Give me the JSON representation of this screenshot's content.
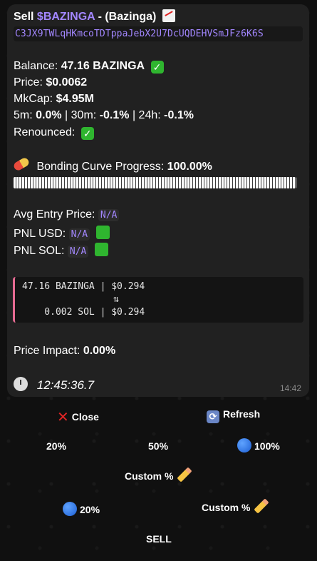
{
  "header": {
    "prefix": "Sell",
    "ticker": "$BAZINGA",
    "separator": "-",
    "name": "(Bazinga)",
    "address": "C3JX9TWLqHKmcoTDTppaJebX2U7DcUQDEHVSmJFz6K6S"
  },
  "stats": {
    "balance_label": "Balance:",
    "balance_value": "47.16 BAZINGA",
    "price_label": "Price:",
    "price_value": "$0.0062",
    "mkcap_label": "MkCap:",
    "mkcap_value": "$4.95M",
    "change_5m_label": "5m:",
    "change_5m": "0.0%",
    "change_30m_label": "30m:",
    "change_30m": "-0.1%",
    "change_24h_label": "24h:",
    "change_24h": "-0.1%",
    "renounced_label": "Renounced:"
  },
  "bonding": {
    "label": "Bonding Curve Progress:",
    "value": "100.00%",
    "progress": 1.0
  },
  "pnl": {
    "avg_entry_label": "Avg Entry Price:",
    "avg_entry_value": "N/A",
    "usd_label": "PNL USD:",
    "usd_value": "N/A",
    "sol_label": "PNL SOL:",
    "sol_value": "N/A"
  },
  "swap": {
    "line1": "47.16 BAZINGA | $0.294",
    "arrow": "⇅",
    "line2": "    0.002 SOL | $0.294"
  },
  "impact": {
    "label": "Price Impact:",
    "value": "0.00%"
  },
  "footer": {
    "time_text": "12:45:36.7",
    "message_time": "14:42"
  },
  "buttons": {
    "close": "Close",
    "refresh": "Refresh",
    "pct_20": "20%",
    "pct_50": "50%",
    "pct_100": "100%",
    "custom_pct": "Custom %",
    "sel_20": "20%",
    "custom_pct_2": "Custom %",
    "sell": "SELL"
  },
  "colors": {
    "accent": "#a387ff",
    "positive": "#2fb52f",
    "swap_border": "#e66b92",
    "bubble": "#212121"
  }
}
